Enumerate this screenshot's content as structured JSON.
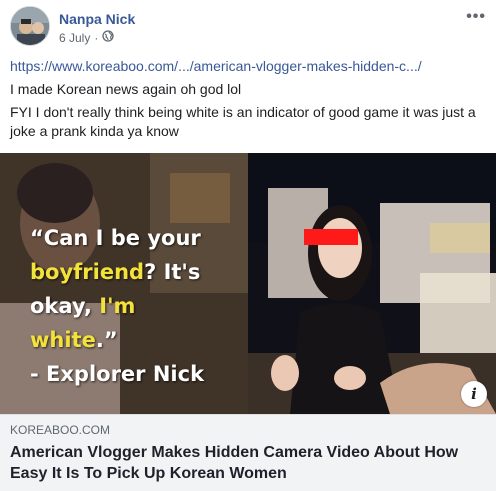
{
  "post": {
    "author": "Nanpa Nick",
    "date": "6 July",
    "separator": "·",
    "privacy_icon": "globe-icon",
    "more_icon": "more-options-icon",
    "more_label": "•••"
  },
  "body": {
    "link_text": "https://www.koreaboo.com/.../american-vlogger-makes-hidden-c.../",
    "line1": "I made Korean news again oh god lol",
    "line2": "FYI I don't really think being white is an indicator of good game it was just a joke a prank kinda ya know"
  },
  "media": {
    "quote_open": "“Can I be your",
    "quote_word_highlight": "boyfriend",
    "quote_mid": "? It's",
    "quote_line3_a": "okay, ",
    "quote_line3_highlight": "I'm white",
    "quote_line3_b": ".”",
    "quote_attribution": "- Explorer Nick",
    "info_label": "i",
    "colors": {
      "quote_text": "#ffffff",
      "quote_highlight": "#f3e23a",
      "censor_bar": "#ff1a1a"
    }
  },
  "card": {
    "domain": "KOREABOO.COM",
    "title": "American Vlogger Makes Hidden Camera Video About How Easy It Is To Pick Up Korean Women"
  },
  "colors": {
    "link": "#385898",
    "meta": "#606770",
    "card_bg": "#f2f3f5"
  }
}
